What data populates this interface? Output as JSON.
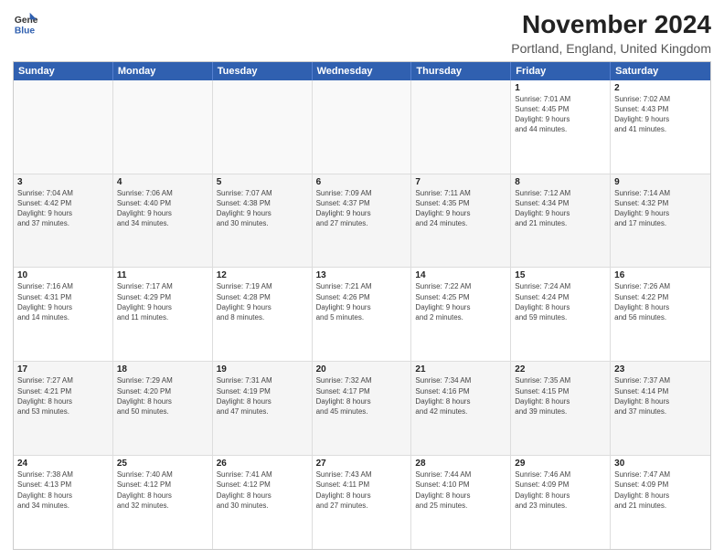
{
  "logo": {
    "text1": "General",
    "text2": "Blue"
  },
  "title": "November 2024",
  "subtitle": "Portland, England, United Kingdom",
  "headers": [
    "Sunday",
    "Monday",
    "Tuesday",
    "Wednesday",
    "Thursday",
    "Friday",
    "Saturday"
  ],
  "rows": [
    [
      {
        "day": "",
        "info": "",
        "empty": true
      },
      {
        "day": "",
        "info": "",
        "empty": true
      },
      {
        "day": "",
        "info": "",
        "empty": true
      },
      {
        "day": "",
        "info": "",
        "empty": true
      },
      {
        "day": "",
        "info": "",
        "empty": true
      },
      {
        "day": "1",
        "info": "Sunrise: 7:01 AM\nSunset: 4:45 PM\nDaylight: 9 hours\nand 44 minutes.",
        "empty": false
      },
      {
        "day": "2",
        "info": "Sunrise: 7:02 AM\nSunset: 4:43 PM\nDaylight: 9 hours\nand 41 minutes.",
        "empty": false
      }
    ],
    [
      {
        "day": "3",
        "info": "Sunrise: 7:04 AM\nSunset: 4:42 PM\nDaylight: 9 hours\nand 37 minutes.",
        "empty": false
      },
      {
        "day": "4",
        "info": "Sunrise: 7:06 AM\nSunset: 4:40 PM\nDaylight: 9 hours\nand 34 minutes.",
        "empty": false
      },
      {
        "day": "5",
        "info": "Sunrise: 7:07 AM\nSunset: 4:38 PM\nDaylight: 9 hours\nand 30 minutes.",
        "empty": false
      },
      {
        "day": "6",
        "info": "Sunrise: 7:09 AM\nSunset: 4:37 PM\nDaylight: 9 hours\nand 27 minutes.",
        "empty": false
      },
      {
        "day": "7",
        "info": "Sunrise: 7:11 AM\nSunset: 4:35 PM\nDaylight: 9 hours\nand 24 minutes.",
        "empty": false
      },
      {
        "day": "8",
        "info": "Sunrise: 7:12 AM\nSunset: 4:34 PM\nDaylight: 9 hours\nand 21 minutes.",
        "empty": false
      },
      {
        "day": "9",
        "info": "Sunrise: 7:14 AM\nSunset: 4:32 PM\nDaylight: 9 hours\nand 17 minutes.",
        "empty": false
      }
    ],
    [
      {
        "day": "10",
        "info": "Sunrise: 7:16 AM\nSunset: 4:31 PM\nDaylight: 9 hours\nand 14 minutes.",
        "empty": false
      },
      {
        "day": "11",
        "info": "Sunrise: 7:17 AM\nSunset: 4:29 PM\nDaylight: 9 hours\nand 11 minutes.",
        "empty": false
      },
      {
        "day": "12",
        "info": "Sunrise: 7:19 AM\nSunset: 4:28 PM\nDaylight: 9 hours\nand 8 minutes.",
        "empty": false
      },
      {
        "day": "13",
        "info": "Sunrise: 7:21 AM\nSunset: 4:26 PM\nDaylight: 9 hours\nand 5 minutes.",
        "empty": false
      },
      {
        "day": "14",
        "info": "Sunrise: 7:22 AM\nSunset: 4:25 PM\nDaylight: 9 hours\nand 2 minutes.",
        "empty": false
      },
      {
        "day": "15",
        "info": "Sunrise: 7:24 AM\nSunset: 4:24 PM\nDaylight: 8 hours\nand 59 minutes.",
        "empty": false
      },
      {
        "day": "16",
        "info": "Sunrise: 7:26 AM\nSunset: 4:22 PM\nDaylight: 8 hours\nand 56 minutes.",
        "empty": false
      }
    ],
    [
      {
        "day": "17",
        "info": "Sunrise: 7:27 AM\nSunset: 4:21 PM\nDaylight: 8 hours\nand 53 minutes.",
        "empty": false
      },
      {
        "day": "18",
        "info": "Sunrise: 7:29 AM\nSunset: 4:20 PM\nDaylight: 8 hours\nand 50 minutes.",
        "empty": false
      },
      {
        "day": "19",
        "info": "Sunrise: 7:31 AM\nSunset: 4:19 PM\nDaylight: 8 hours\nand 47 minutes.",
        "empty": false
      },
      {
        "day": "20",
        "info": "Sunrise: 7:32 AM\nSunset: 4:17 PM\nDaylight: 8 hours\nand 45 minutes.",
        "empty": false
      },
      {
        "day": "21",
        "info": "Sunrise: 7:34 AM\nSunset: 4:16 PM\nDaylight: 8 hours\nand 42 minutes.",
        "empty": false
      },
      {
        "day": "22",
        "info": "Sunrise: 7:35 AM\nSunset: 4:15 PM\nDaylight: 8 hours\nand 39 minutes.",
        "empty": false
      },
      {
        "day": "23",
        "info": "Sunrise: 7:37 AM\nSunset: 4:14 PM\nDaylight: 8 hours\nand 37 minutes.",
        "empty": false
      }
    ],
    [
      {
        "day": "24",
        "info": "Sunrise: 7:38 AM\nSunset: 4:13 PM\nDaylight: 8 hours\nand 34 minutes.",
        "empty": false
      },
      {
        "day": "25",
        "info": "Sunrise: 7:40 AM\nSunset: 4:12 PM\nDaylight: 8 hours\nand 32 minutes.",
        "empty": false
      },
      {
        "day": "26",
        "info": "Sunrise: 7:41 AM\nSunset: 4:12 PM\nDaylight: 8 hours\nand 30 minutes.",
        "empty": false
      },
      {
        "day": "27",
        "info": "Sunrise: 7:43 AM\nSunset: 4:11 PM\nDaylight: 8 hours\nand 27 minutes.",
        "empty": false
      },
      {
        "day": "28",
        "info": "Sunrise: 7:44 AM\nSunset: 4:10 PM\nDaylight: 8 hours\nand 25 minutes.",
        "empty": false
      },
      {
        "day": "29",
        "info": "Sunrise: 7:46 AM\nSunset: 4:09 PM\nDaylight: 8 hours\nand 23 minutes.",
        "empty": false
      },
      {
        "day": "30",
        "info": "Sunrise: 7:47 AM\nSunset: 4:09 PM\nDaylight: 8 hours\nand 21 minutes.",
        "empty": false
      }
    ]
  ]
}
